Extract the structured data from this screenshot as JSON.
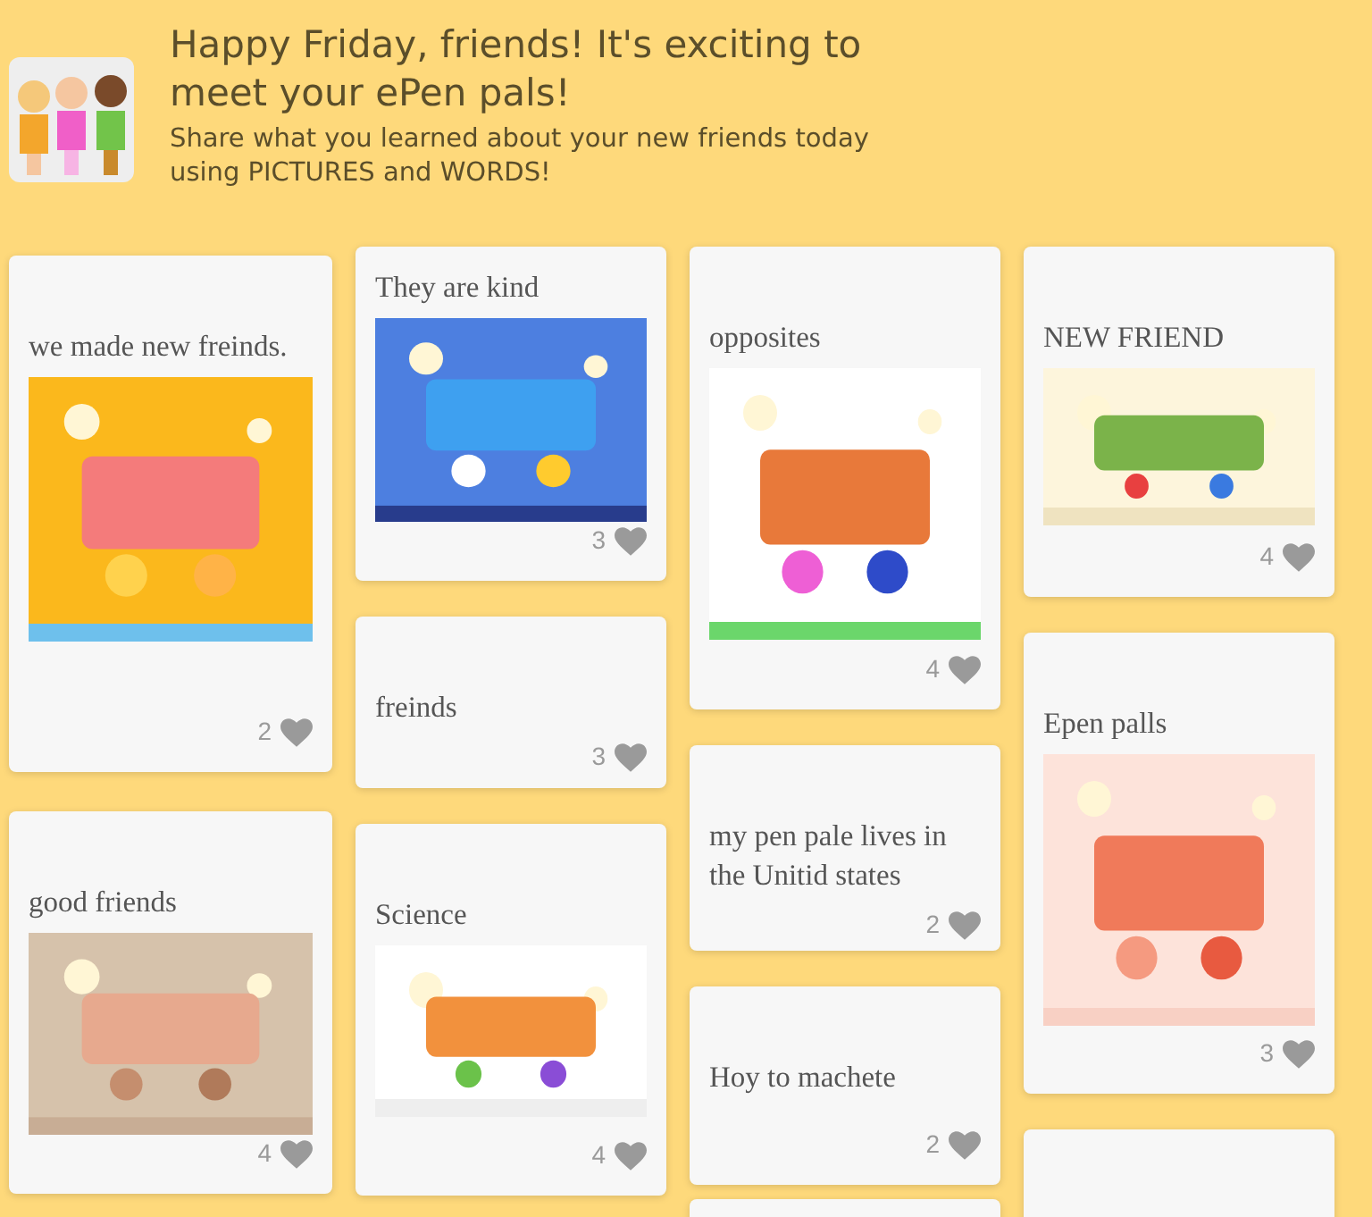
{
  "header": {
    "title": "Happy Friday, friends! It's exciting to meet your ePen pals!",
    "subtitle": "Share what you learned about your new friends today using PICTURES and WORDS!"
  },
  "columns": [
    {
      "posts": [
        {
          "title": "we made new freinds.",
          "likes": "2"
        },
        {
          "title": "good friends",
          "likes": "4"
        }
      ]
    },
    {
      "posts": [
        {
          "title": "They are kind",
          "likes": "3"
        },
        {
          "kind": "text",
          "title": "freinds",
          "likes": "3"
        },
        {
          "title": "Science",
          "likes": "4"
        }
      ]
    },
    {
      "posts": [
        {
          "title": "opposites",
          "likes": "4"
        },
        {
          "kind": "text",
          "title": "my pen pale lives in the Unitid states",
          "likes": "2"
        },
        {
          "kind": "text",
          "title": "Hoy to machete",
          "likes": "2"
        },
        {
          "kind": "hidden"
        }
      ]
    },
    {
      "posts": [
        {
          "title": "NEW FRIEND",
          "likes": "4"
        },
        {
          "title": "Epen palls",
          "likes": "3"
        },
        {
          "kind": "hidden"
        }
      ]
    }
  ]
}
